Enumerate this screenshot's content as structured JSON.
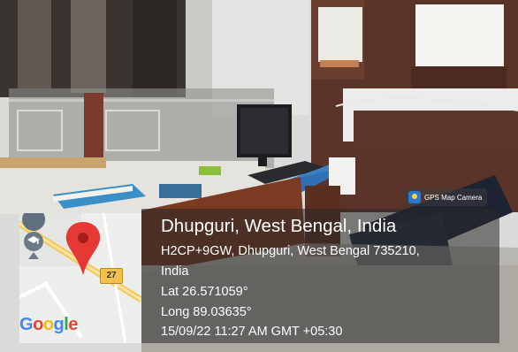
{
  "overlay": {
    "app_badge": "GPS Map Camera",
    "location_title": "Dhupguri, West Bengal, India",
    "address_line1": "H2CP+9GW, Dhupguri, West Bengal 735210,",
    "address_line2": "India",
    "latitude": "Lat 26.571059°",
    "longitude": "Long 89.03635°",
    "datetime": "15/09/22 11:27 AM GMT +05:30"
  },
  "map": {
    "road_shield": "27",
    "logo_letters": [
      "G",
      "o",
      "o",
      "g",
      "l",
      "e"
    ],
    "logo_colors": [
      "#4285f4",
      "#ea4335",
      "#fbbc05",
      "#4285f4",
      "#34a853",
      "#ea4335"
    ],
    "pin_color": "#e53935",
    "icons": [
      "map-pin-icon",
      "education-marker-icon"
    ]
  }
}
